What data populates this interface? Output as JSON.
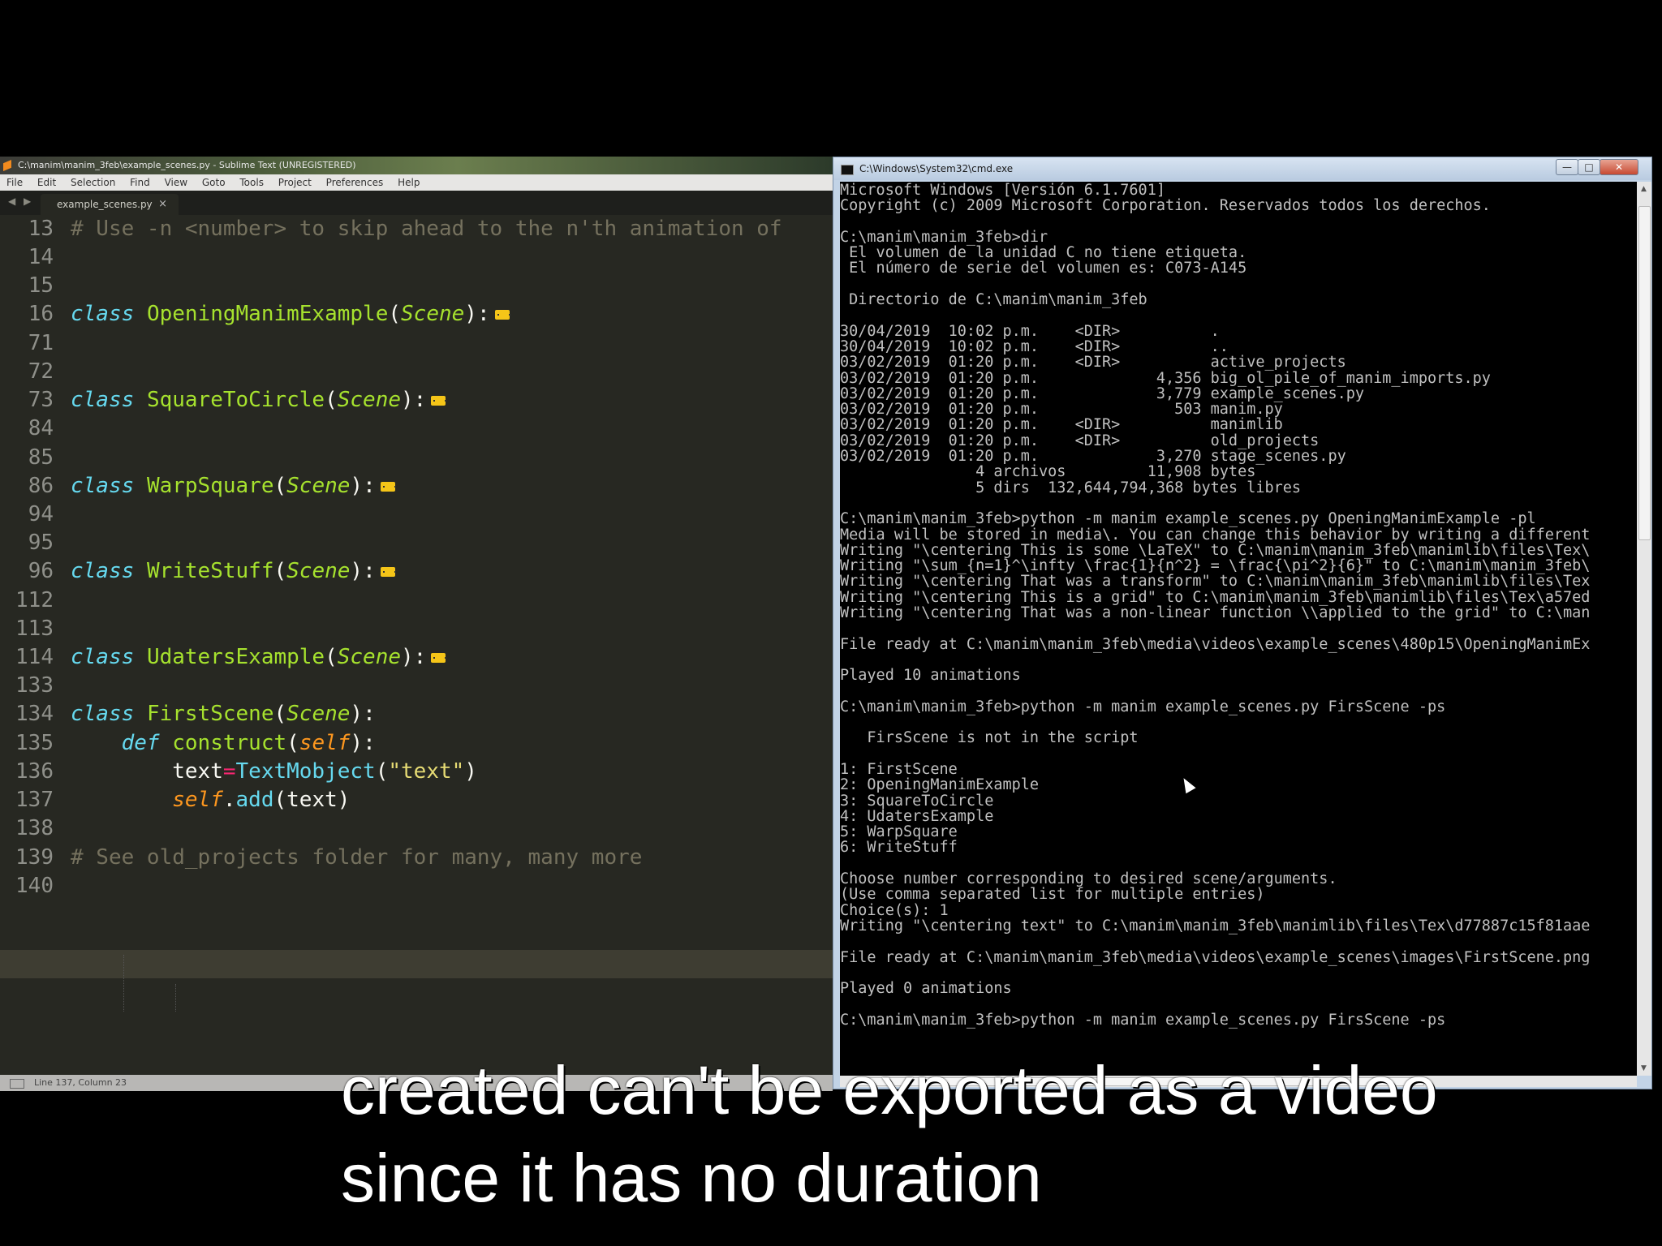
{
  "sublime": {
    "title": "C:\\manim\\manim_3feb\\example_scenes.py - Sublime Text (UNREGISTERED)",
    "menu": [
      "File",
      "Edit",
      "Selection",
      "Find",
      "View",
      "Goto",
      "Tools",
      "Project",
      "Preferences",
      "Help"
    ],
    "tab_label": "example_scenes.py",
    "tab_close": "×",
    "nav_arrows": "◀ ▶",
    "code": {
      "l13": "# Use -n <number> to skip ahead to the n'th animation of",
      "kw_class": "class",
      "kw_def": "def",
      "scene": "Scene",
      "self": "self",
      "cls1": "OpeningManimExample",
      "cls2": "SquareToCircle",
      "cls3": "WarpSquare",
      "cls4": "WriteStuff",
      "cls5": "UdatersExample",
      "cls6": "FirstScene",
      "construct": "construct",
      "text_var": "text",
      "eq": "=",
      "textmobject": "TextMobject",
      "text_str": "\"text\"",
      "add": "add",
      "add_arg": "(text)",
      "l139": "# See old_projects folder for many, many more"
    },
    "line_numbers": [
      "13",
      "14",
      "15",
      "16",
      "71",
      "72",
      "73",
      "84",
      "85",
      "86",
      "94",
      "95",
      "96",
      "112",
      "113",
      "114",
      "133",
      "134",
      "135",
      "136",
      "137",
      "138",
      "139",
      "140"
    ],
    "status": "Line 137, Column 23"
  },
  "cmd": {
    "title": "C:\\Windows\\System32\\cmd.exe",
    "buttons": {
      "min": "—",
      "max": "□",
      "close": "✕"
    },
    "output": [
      "Microsoft Windows [Versión 6.1.7601]",
      "Copyright (c) 2009 Microsoft Corporation. Reservados todos los derechos.",
      "",
      "C:\\manim\\manim_3feb>dir",
      " El volumen de la unidad C no tiene etiqueta.",
      " El número de serie del volumen es: C073-A145",
      "",
      " Directorio de C:\\manim\\manim_3feb",
      "",
      "30/04/2019  10:02 p.m.    <DIR>          .",
      "30/04/2019  10:02 p.m.    <DIR>          ..",
      "03/02/2019  01:20 p.m.    <DIR>          active_projects",
      "03/02/2019  01:20 p.m.             4,356 big_ol_pile_of_manim_imports.py",
      "03/02/2019  01:20 p.m.             3,779 example_scenes.py",
      "03/02/2019  01:20 p.m.               503 manim.py",
      "03/02/2019  01:20 p.m.    <DIR>          manimlib",
      "03/02/2019  01:20 p.m.    <DIR>          old_projects",
      "03/02/2019  01:20 p.m.             3,270 stage_scenes.py",
      "               4 archivos         11,908 bytes",
      "               5 dirs  132,644,794,368 bytes libres",
      "",
      "C:\\manim\\manim_3feb>python -m manim example_scenes.py OpeningManimExample -pl",
      "Media will be stored in media\\. You can change this behavior by writing a different",
      "Writing \"\\centering This is some \\LaTeX\" to C:\\manim\\manim_3feb\\manimlib\\files\\Tex\\",
      "Writing \"\\sum_{n=1}^\\infty \\frac{1}{n^2} = \\frac{\\pi^2}{6}\" to C:\\manim\\manim_3feb\\",
      "Writing \"\\centering That was a transform\" to C:\\manim\\manim_3feb\\manimlib\\files\\Tex",
      "Writing \"\\centering This is a grid\" to C:\\manim\\manim_3feb\\manimlib\\files\\Tex\\a57ed",
      "Writing \"\\centering That was a non-linear function \\\\applied to the grid\" to C:\\man",
      "",
      "File ready at C:\\manim\\manim_3feb\\media\\videos\\example_scenes\\480p15\\OpeningManimEx",
      "",
      "Played 10 animations",
      "",
      "C:\\manim\\manim_3feb>python -m manim example_scenes.py FirsScene -ps",
      "",
      "   FirsScene is not in the script",
      "",
      "1: FirstScene",
      "2: OpeningManimExample",
      "3: SquareToCircle",
      "4: UdatersExample",
      "5: WarpSquare",
      "6: WriteStuff",
      "",
      "Choose number corresponding to desired scene/arguments.",
      "(Use comma separated list for multiple entries)",
      "Choice(s): 1",
      "Writing \"\\centering text\" to C:\\manim\\manim_3feb\\manimlib\\files\\Tex\\d77887c15f81aae",
      "",
      "File ready at C:\\manim\\manim_3feb\\media\\videos\\example_scenes\\images\\FirstScene.png",
      "",
      "Played 0 animations",
      "",
      "C:\\manim\\manim_3feb>python -m manim example_scenes.py FirsScene -ps"
    ]
  },
  "subtitle": {
    "line1": "created can't be exported as a video",
    "line2": "since it has no duration"
  }
}
